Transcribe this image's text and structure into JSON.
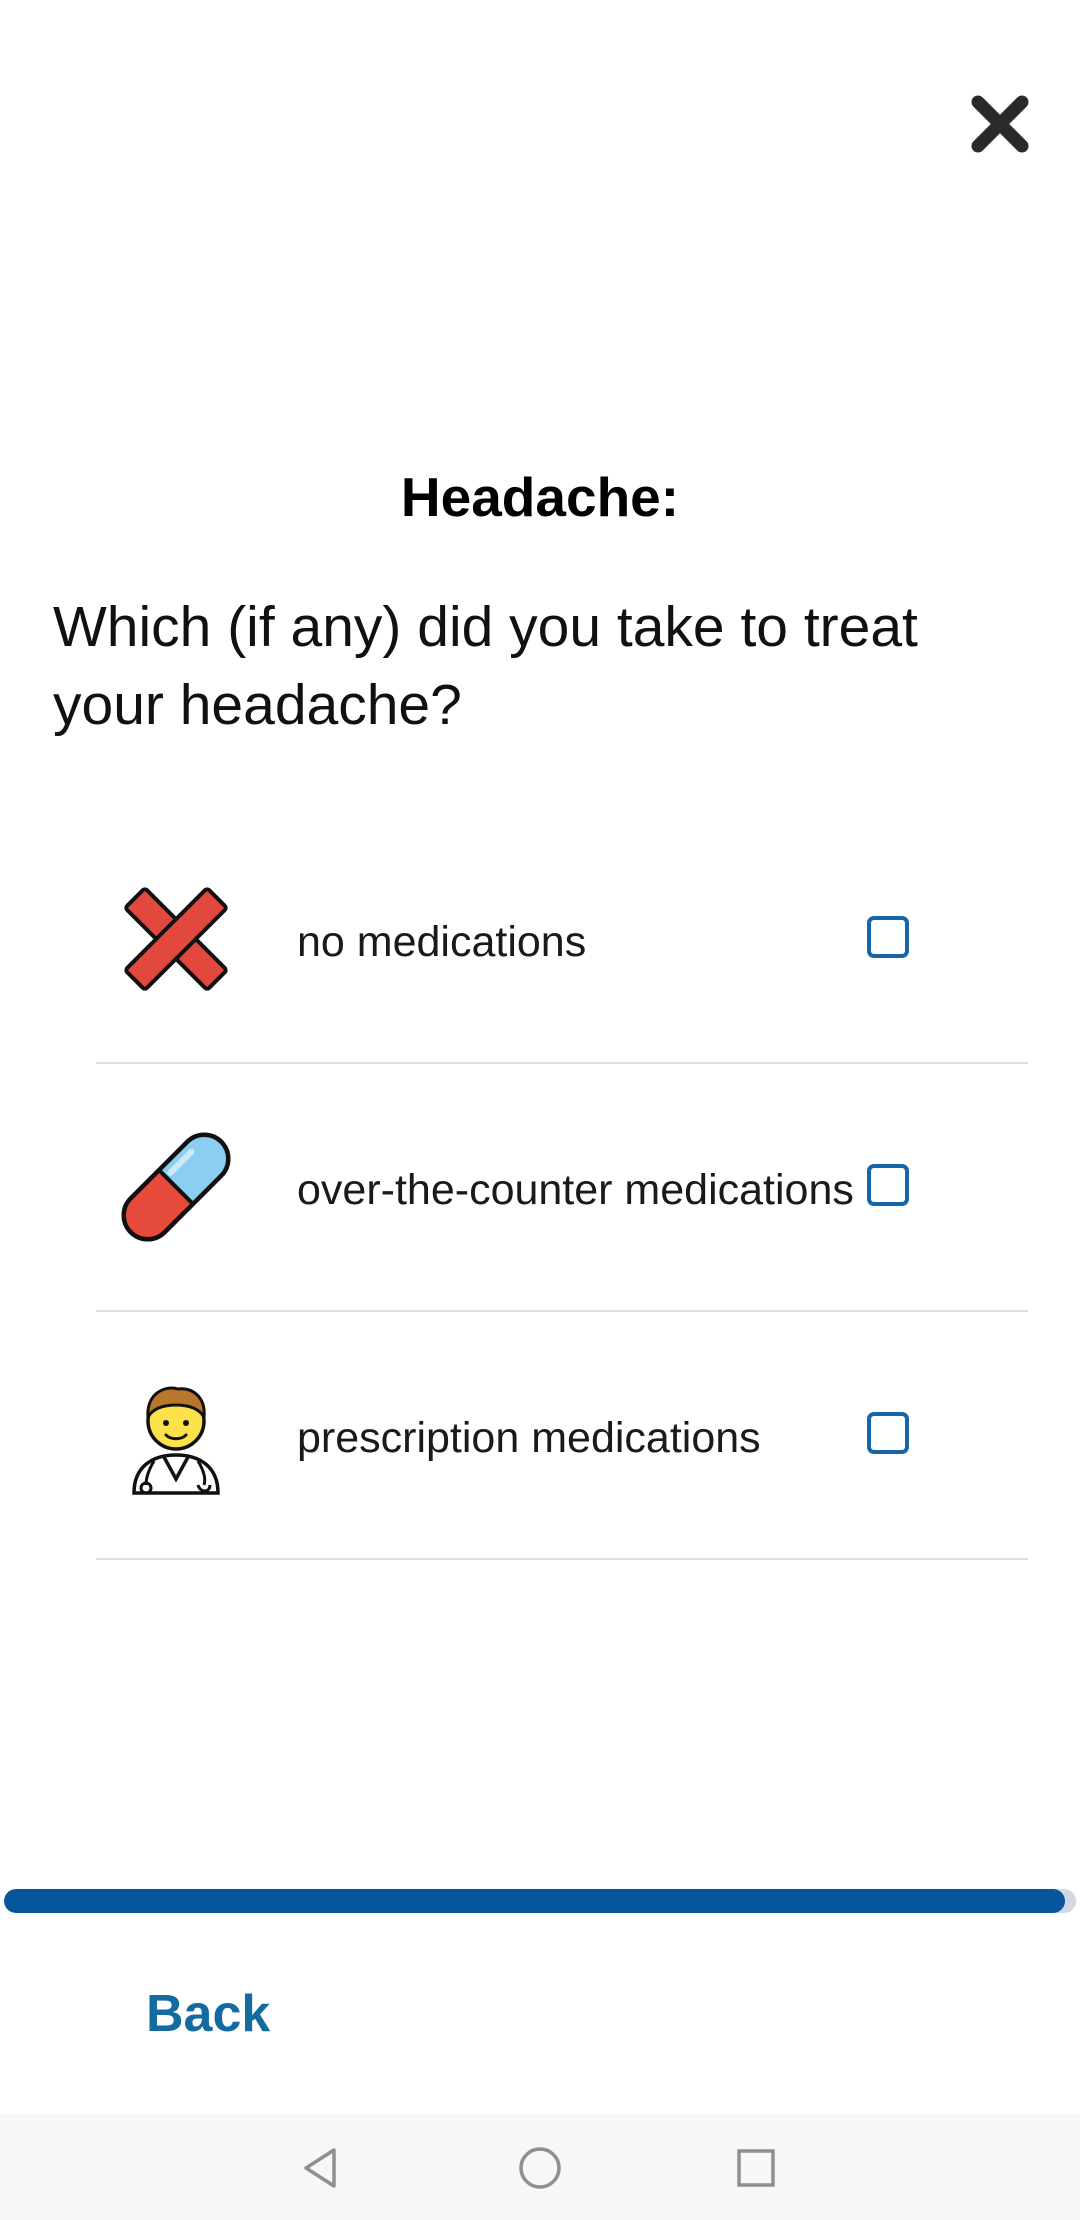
{
  "header": {
    "close_icon": "close-icon"
  },
  "screen": {
    "title": "Headache:",
    "question": "Which (if any) did you take to treat your headache?"
  },
  "options": [
    {
      "label": "no medications",
      "icon": "red-cross-mark-icon",
      "checked": false
    },
    {
      "label": "over-the-counter medications",
      "icon": "pill-icon",
      "checked": false
    },
    {
      "label": "prescription medications",
      "icon": "doctor-icon",
      "checked": false
    }
  ],
  "progress": {
    "fraction": 0.99
  },
  "footer": {
    "back_label": "Back"
  },
  "nav": {
    "icons": [
      "back-triangle-icon",
      "home-circle-icon",
      "recents-square-icon"
    ]
  },
  "colors": {
    "accent": "#07569c",
    "checkbox": "#1565a8",
    "back_text": "#136ba0"
  }
}
